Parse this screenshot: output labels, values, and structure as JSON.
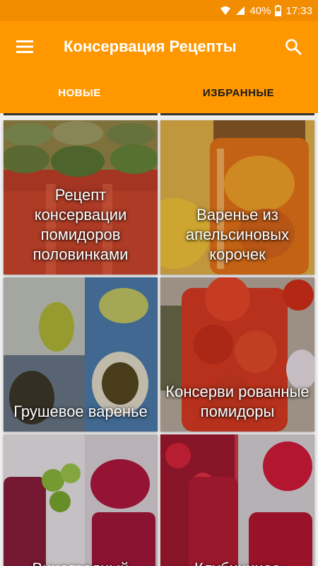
{
  "status_bar": {
    "battery": "40%",
    "time": "17:33",
    "icons": [
      "wifi-icon",
      "signal-icon",
      "battery-icon"
    ]
  },
  "app_bar": {
    "title": "Консервация Рецепты",
    "menu_icon": "hamburger-menu-icon",
    "search_icon": "search-icon"
  },
  "tabs": [
    {
      "label": "НОВЫЕ",
      "active": true
    },
    {
      "label": "ИЗБРАННЫЕ",
      "active": false
    }
  ],
  "recipes": [
    {
      "caption": "Рецепт консервации помидоров половинками"
    },
    {
      "caption": "Варенье из апельсиновых корочек"
    },
    {
      "caption": "Грушевое варенье"
    },
    {
      "caption": "Консерви рованные помидоры"
    },
    {
      "caption": "Виноградный"
    },
    {
      "caption": "Клубничное"
    }
  ],
  "colors": {
    "accent": "#ff9800",
    "status_bar": "#f28c00"
  }
}
